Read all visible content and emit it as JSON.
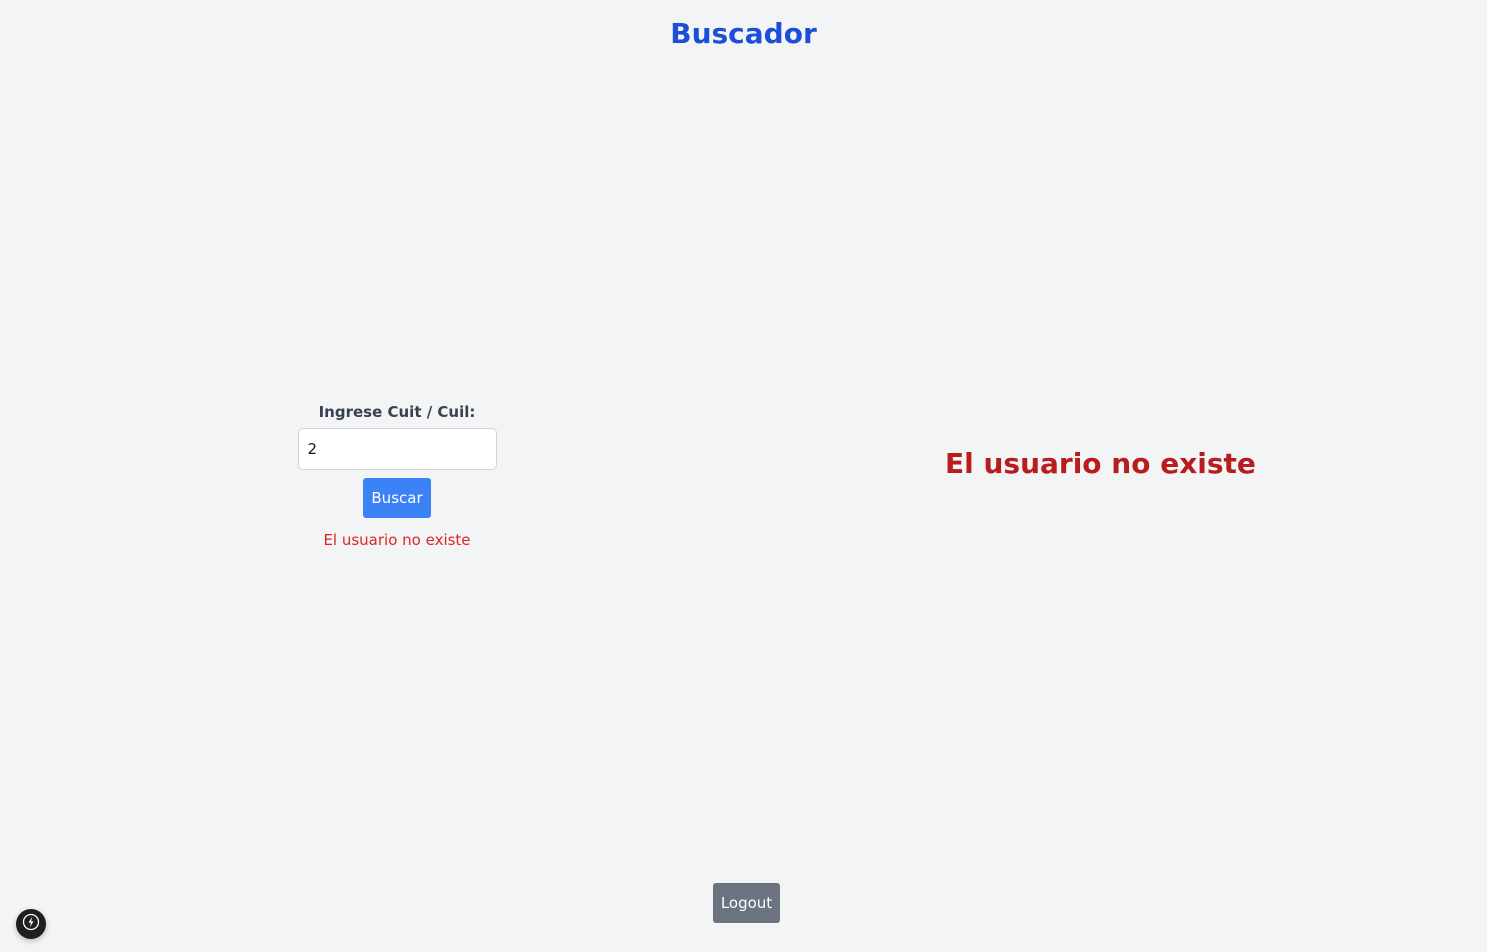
{
  "header": {
    "title": "Buscador"
  },
  "search": {
    "label": "Ingrese Cuit / Cuil:",
    "value": "2",
    "button_label": "Buscar",
    "error_text": "El usuario no existe"
  },
  "result": {
    "message": "El usuario no existe"
  },
  "footer": {
    "logout_label": "Logout",
    "dev_badge_icon": "lightning-icon"
  },
  "colors": {
    "background": "#f3f4f6",
    "title": "#1d4ed8",
    "primary_button": "#3b82f6",
    "error_text": "#dc2626",
    "result_error": "#b91c1c",
    "logout_button": "#6b7280"
  }
}
